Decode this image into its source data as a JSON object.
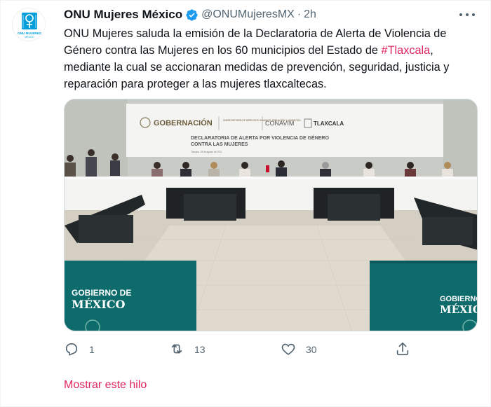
{
  "tweet": {
    "display_name": "ONU Mujeres México",
    "handle": "@ONUMujeresMX",
    "separator": "·",
    "time": "2h",
    "avatar": {
      "logo_text": "ONU MUJERES",
      "sub_text": "MÉXICO",
      "icon": "un-women-logo-icon",
      "brand_color": "#009edb"
    },
    "text_lines": [
      "ONU Mujeres saluda la emisión de la Declaratoria de Alerta de Violencia de",
      "Género contra las Mujeres en los 60 municipios del Estado de ",
      "mediante la cual se accionaran medidas de prevención, seguridad, justicia y",
      "reparación para proteger a las mujeres tlaxcaltecas."
    ],
    "hashtag": "#Tlaxcala",
    "hashtag_suffix": ",",
    "hashtag_color": "#e0245e",
    "media": {
      "banner_gobernacion": "GOBERNACIÓN",
      "banner_subsecretaria": "SUBSECRETARÍA DE DERECHOS HUMANOS, POBLACIÓN Y MIGRACIÓN",
      "banner_conavim": "CONAVIM",
      "banner_tlaxcala": "TLAXCALA",
      "banner_title_1": "DECLARATORIA DE ALERTA POR VIOLENCIA DE GÉNERO",
      "banner_title_2": "CONTRA LAS MUJERES",
      "banner_date": "Tlaxcala, 18 de agosto de 2021",
      "panel_left_1": "GOBIERNO DE",
      "panel_left_2": "MÉXICO",
      "panel_right_1": "GOBIERNO",
      "panel_right_2": "MÉXIC"
    },
    "actions": {
      "reply_count": "1",
      "retweet_count": "13",
      "like_count": "30"
    },
    "show_thread": "Mostrar este hilo"
  }
}
